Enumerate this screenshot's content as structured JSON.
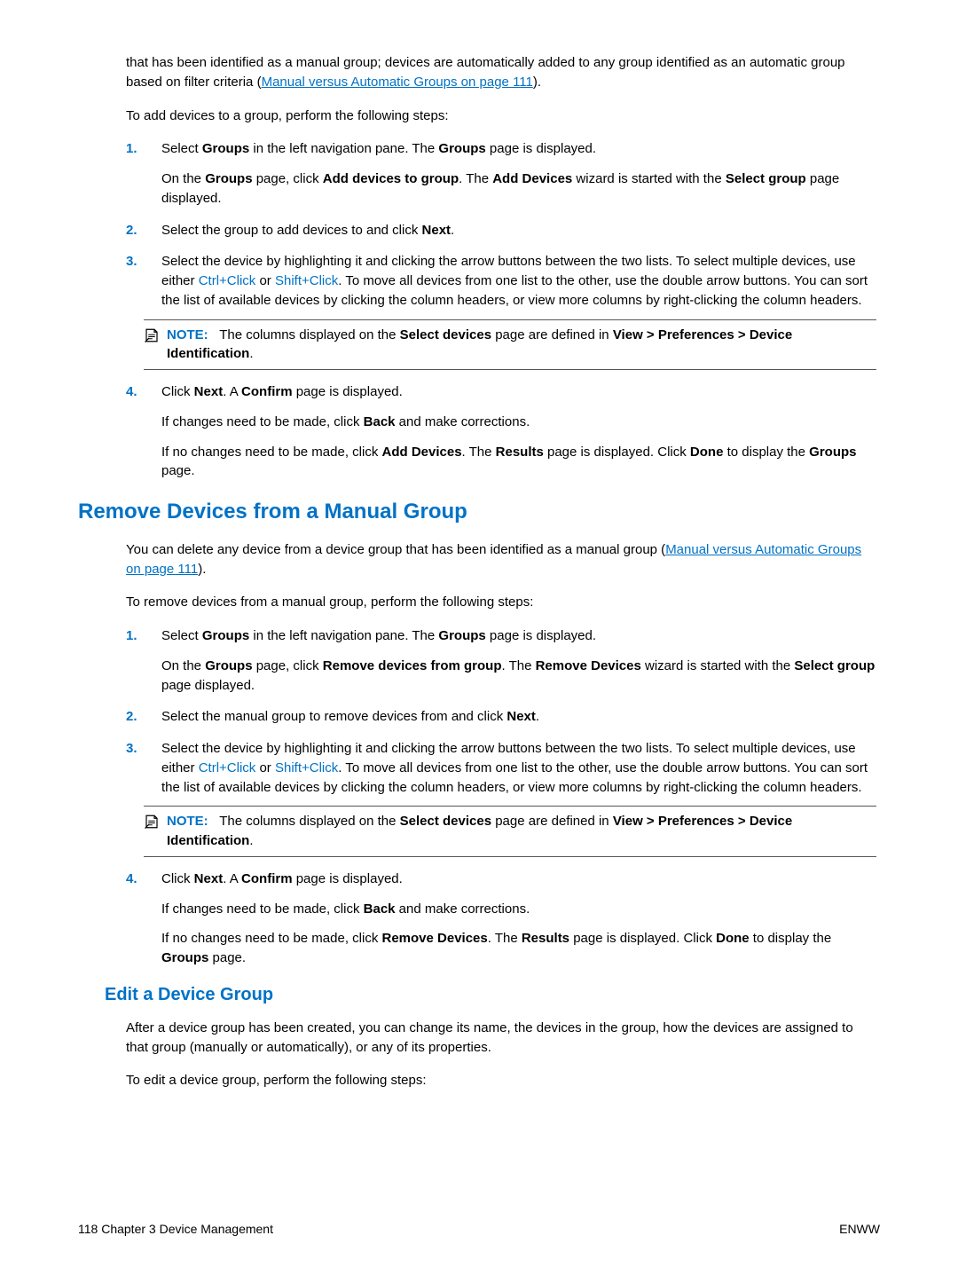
{
  "intro_para": {
    "pre": "that has been identified as a manual group; devices are automatically added to any group identified as an automatic group based on filter criteria (",
    "link": "Manual versus Automatic Groups on page 111",
    "post": ")."
  },
  "add_devices_lead": "To add devices to a group, perform the following steps:",
  "add": {
    "s1a_pre": "Select ",
    "s1a_groups": "Groups",
    "s1a_mid": " in the left navigation pane. The ",
    "s1a_page": "Groups",
    "s1a_post": " page is displayed.",
    "s1b_pre": "On the ",
    "s1b_groups": "Groups",
    "s1b_mid1": " page, click ",
    "s1b_action": "Add devices to group",
    "s1b_mid2": ". The ",
    "s1b_wizard": "Add Devices",
    "s1b_mid3": " wizard is started with the ",
    "s1b_select": "Select group",
    "s1b_post": " page displayed.",
    "s2_pre": "Select the group to add devices to and click ",
    "s2_next": "Next",
    "s2_post": ".",
    "s3a": "Select the device by highlighting it and clicking the arrow buttons between the two lists. To select multiple devices, use either ",
    "s3_ctrl": "Ctrl+Click",
    "s3_or": " or ",
    "s3_shift": "Shift+Click",
    "s3b": ". To move all devices from one list to the other, use the double arrow buttons. You can sort the list of available devices by clicking the column headers, or view more columns by right-clicking the column headers.",
    "note_label": "NOTE:",
    "note_pre": "The columns displayed on the ",
    "note_sel": "Select devices",
    "note_mid": " page are defined in ",
    "note_path": "View > Preferences > Device Identification",
    "note_post": ".",
    "s4a_pre": "Click ",
    "s4a_next": "Next",
    "s4a_mid": ". A ",
    "s4a_confirm": "Confirm",
    "s4a_post": " page is displayed.",
    "s4b_pre": "If changes need to be made, click ",
    "s4b_back": "Back",
    "s4b_post": " and make corrections.",
    "s4c_pre": "If no changes need to be made, click ",
    "s4c_add": "Add Devices",
    "s4c_mid1": ". The ",
    "s4c_results": "Results",
    "s4c_mid2": " page is displayed. Click ",
    "s4c_done": "Done",
    "s4c_mid3": " to display the ",
    "s4c_groups": "Groups",
    "s4c_post": " page."
  },
  "remove_heading": "Remove Devices from a Manual Group",
  "remove_intro": {
    "pre": "You can delete any device from a device group that has been identified as a manual group (",
    "link": "Manual versus Automatic Groups on page 111",
    "post": ")."
  },
  "remove_lead": "To remove devices from a manual group, perform the following steps:",
  "remove": {
    "s1a_pre": "Select ",
    "s1a_groups": "Groups",
    "s1a_mid": " in the left navigation pane. The ",
    "s1a_page": "Groups",
    "s1a_post": " page is displayed.",
    "s1b_pre": "On the ",
    "s1b_groups": "Groups",
    "s1b_mid1": " page, click ",
    "s1b_action": "Remove devices from group",
    "s1b_mid2": ". The ",
    "s1b_wizard": "Remove Devices",
    "s1b_mid3": " wizard is started with the ",
    "s1b_select": "Select group",
    "s1b_post": " page displayed.",
    "s2_pre": "Select the manual group to remove devices from and click ",
    "s2_next": "Next",
    "s2_post": ".",
    "s3a": "Select the device by highlighting it and clicking the arrow buttons between the two lists. To select multiple devices, use either ",
    "s3_ctrl": "Ctrl+Click",
    "s3_or": " or ",
    "s3_shift": "Shift+Click",
    "s3b": ". To move all devices from one list to the other, use the double arrow buttons. You can sort the list of available devices by clicking the column headers, or view more columns by right-clicking the column headers.",
    "note_label": "NOTE:",
    "note_pre": "The columns displayed on the ",
    "note_sel": "Select devices",
    "note_mid": " page are defined in ",
    "note_path": "View > Preferences > Device Identification",
    "note_post": ".",
    "s4a_pre": "Click ",
    "s4a_next": "Next",
    "s4a_mid": ". A ",
    "s4a_confirm": "Confirm",
    "s4a_post": " page is displayed.",
    "s4b_pre": "If changes need to be made, click ",
    "s4b_back": "Back",
    "s4b_post": " and make corrections.",
    "s4c_pre": "If no changes need to be made, click ",
    "s4c_add": "Remove Devices",
    "s4c_mid1": ". The ",
    "s4c_results": "Results",
    "s4c_mid2": " page is displayed. Click ",
    "s4c_done": "Done",
    "s4c_mid3": " to display the ",
    "s4c_groups": "Groups",
    "s4c_post": " page."
  },
  "edit_heading": "Edit a Device Group",
  "edit_intro": "After a device group has been created, you can change its name, the devices in the group, how the devices are assigned to that group (manually or automatically), or any of its properties.",
  "edit_lead": "To edit a device group, perform the following steps:",
  "footer": {
    "left": "118   Chapter 3   Device Management",
    "right": "ENWW"
  },
  "nums": {
    "n1": "1.",
    "n2": "2.",
    "n3": "3.",
    "n4": "4."
  }
}
